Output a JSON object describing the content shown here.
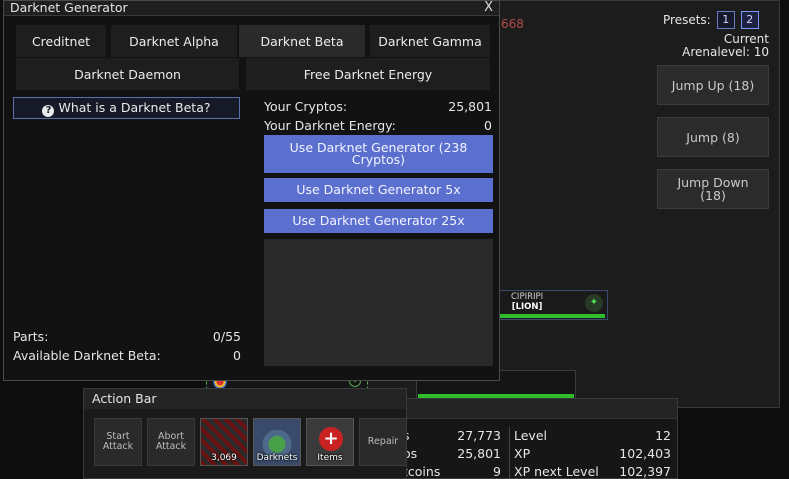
{
  "arena": {
    "ghost_number": "668",
    "presets_label": "Presets:",
    "presets": [
      "1",
      "2"
    ],
    "current_label": "Current",
    "arenalevel_label": "Arenalevel: 10",
    "jump_up": "Jump Up (18)",
    "jump": "Jump (8)",
    "jump_down": "Jump Down (18)",
    "opponent_name": "CIPIRIPI",
    "opponent_tag": "[LION]"
  },
  "modal": {
    "title": "Darknet Generator",
    "close": "X",
    "tabs": [
      "Creditnet",
      "Darknet Alpha",
      "Darknet Beta",
      "Darknet Gamma",
      "Darknet Daemon",
      "Free Darknet Energy"
    ],
    "active_tab": "Darknet Beta",
    "whatis_label": "What is a Darknet Beta?",
    "your_cryptos_label": "Your Cryptos:",
    "your_cryptos_value": "25,801",
    "your_energy_label": "Your Darknet Energy:",
    "your_energy_value": "0",
    "use_1": "Use Darknet Generator (238 Cryptos)",
    "use_5": "Use Darknet Generator 5x",
    "use_25": "Use Darknet Generator 25x",
    "parts_label": "Parts:",
    "parts_value": "0/55",
    "available_label": "Available Darknet Beta:",
    "available_value": "0"
  },
  "action_bar": {
    "title": "Action Bar",
    "start_attack": "Start Attack",
    "abort_attack": "Abort Attack",
    "cryptos_caption": "3,069",
    "darknets_caption": "Darknets",
    "items_caption": "Items",
    "repair": "Repair"
  },
  "stats": {
    "left": [
      {
        "label": "s",
        "value": "27,773"
      },
      {
        "label": "os",
        "value": "25,801"
      },
      {
        "label": "tcoins",
        "value": "9"
      }
    ],
    "right": [
      {
        "label": "Level",
        "value": "12"
      },
      {
        "label": "XP",
        "value": "102,403"
      },
      {
        "label": "XP next Level",
        "value": "102,397"
      }
    ]
  },
  "colors": {
    "accent_button": "#5b6fcf",
    "hp_green": "#2fbd2f",
    "preset_border": "#6a7ec8"
  }
}
